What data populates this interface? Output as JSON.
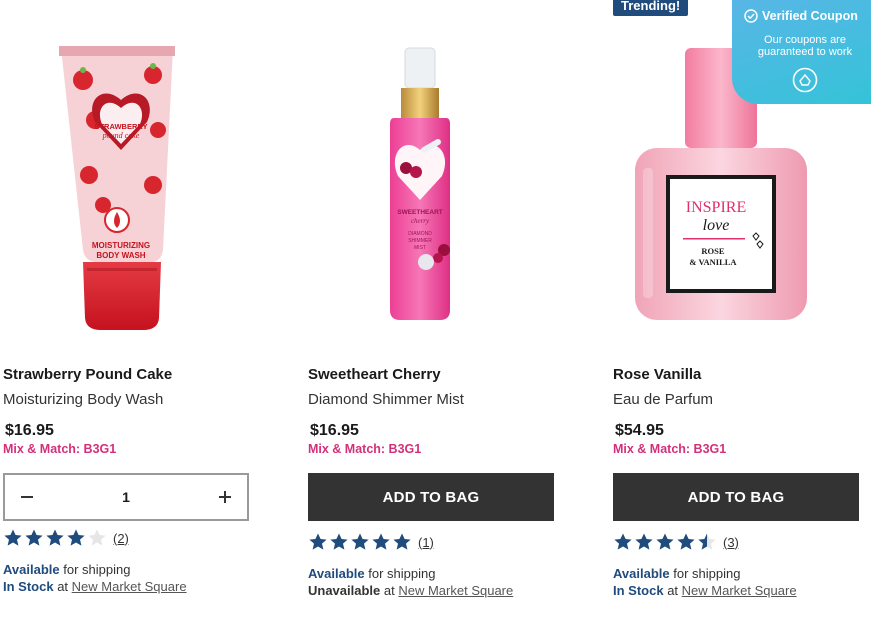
{
  "products": [
    {
      "name": "Strawberry Pound Cake",
      "type": "Moisturizing Body Wash",
      "price": "$16.95",
      "promo": "Mix & Match: B3G1",
      "quantity": "1",
      "rating": 4,
      "review_count": "(2)",
      "shipping_status": "Available",
      "shipping_text": "for shipping",
      "store_status": "In Stock",
      "store_at": "at",
      "store_name": "New Market Square"
    },
    {
      "name": "Sweetheart Cherry",
      "type": "Diamond Shimmer Mist",
      "price": "$16.95",
      "promo": "Mix & Match: B3G1",
      "button_label": "ADD TO BAG",
      "rating": 5,
      "review_count": "(1)",
      "shipping_status": "Available",
      "shipping_text": "for shipping",
      "store_status": "Unavailable",
      "store_at": "at",
      "store_name": "New Market Square"
    },
    {
      "badge": "Trending!",
      "name": "Rose Vanilla",
      "type": "Eau de Parfum",
      "price": "$54.95",
      "promo": "Mix & Match: B3G1",
      "button_label": "ADD TO BAG",
      "rating": 4.5,
      "review_count": "(3)",
      "shipping_status": "Available",
      "shipping_text": "for shipping",
      "store_status": "In Stock",
      "store_at": "at",
      "store_name": "New Market Square"
    }
  ],
  "coupon_widget": {
    "title": "Verified Coupon",
    "text": "Our coupons are guaranteed to work"
  },
  "product_images": {
    "body_wash": {
      "label_line1": "STRAWBERRY",
      "label_line2": "pound cake",
      "product_line1": "MOISTURIZING",
      "product_line2": "BODY WASH"
    },
    "mist": {
      "label_line1": "SWEETHEART",
      "label_line2": "cherry",
      "product_line1": "DIAMOND",
      "product_line2": "SHIMMER",
      "product_line3": "MIST"
    },
    "perfume": {
      "label_line1": "INSPIRE",
      "label_line2": "love",
      "label_line3": "ROSE",
      "label_line4": "& VANILLA"
    }
  },
  "colors": {
    "accent_blue": "#1f4b7d",
    "promo_pink": "#d4307a",
    "button_dark": "#333333",
    "star": "#1f4b7d"
  },
  "icons": {
    "star": "star-icon",
    "minus": "minus-icon",
    "plus": "plus-icon",
    "check": "check-circle-icon",
    "coupon": "coupon-logo-icon"
  }
}
